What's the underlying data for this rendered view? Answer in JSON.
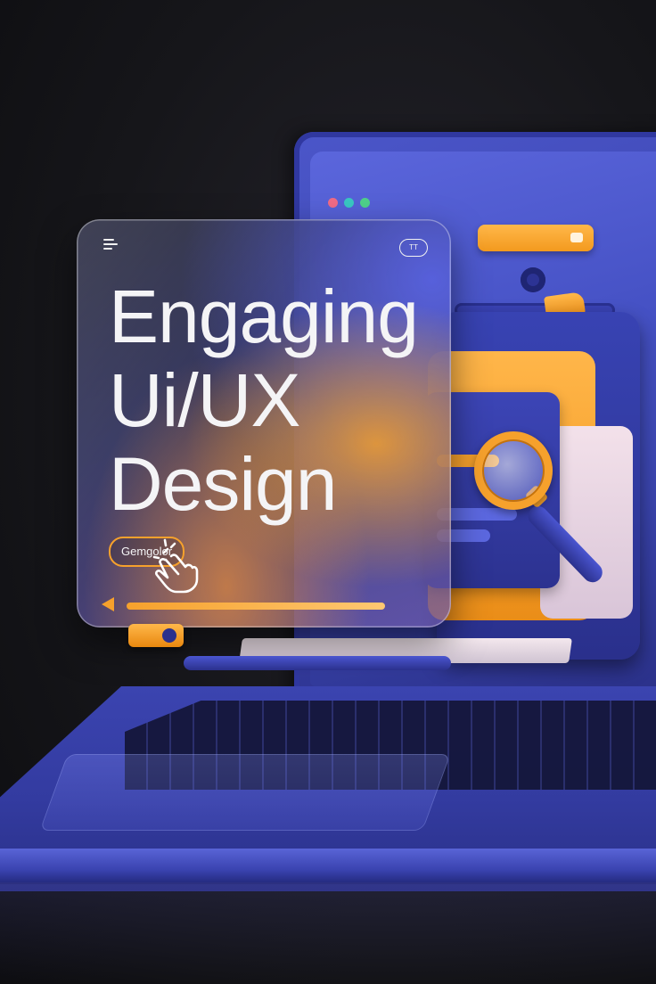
{
  "hero": {
    "headline": "Engaging\nUi/UX\nDesign",
    "cta_label": "Gemgolor",
    "badge_label": "TT"
  },
  "icons": {
    "menu": "hamburger-menu-icon",
    "hand": "pointing-hand-icon",
    "search": "magnifying-glass-icon"
  },
  "colors": {
    "accent_orange": "#f6a12c",
    "brand_blue": "#4551c4",
    "background": "#16161a",
    "text": "#f4f4f6",
    "dot_red": "#f06b86",
    "dot_teal": "#39c7c2",
    "dot_green": "#4ed08a"
  }
}
